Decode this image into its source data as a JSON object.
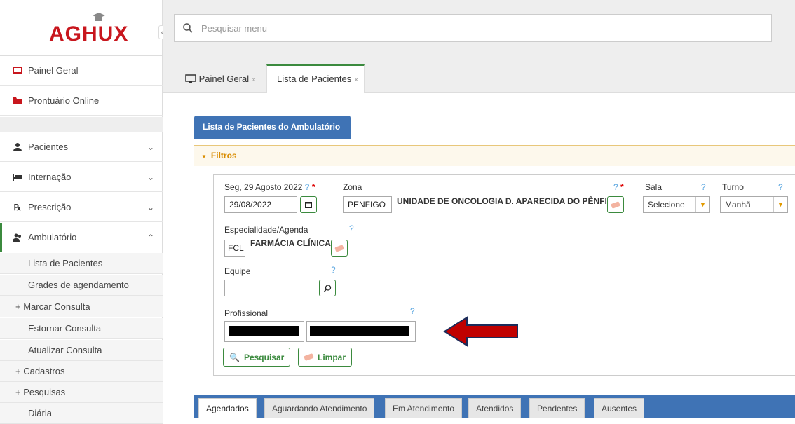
{
  "logo": {
    "text": "AGHUX"
  },
  "sidebar": {
    "collapse_label": "«",
    "items": [
      {
        "label": "Painel Geral",
        "icon": "monitor-icon"
      },
      {
        "label": "Prontuário Online",
        "icon": "folder-icon"
      },
      {
        "label": "Pacientes",
        "icon": "user-icon"
      },
      {
        "label": "Internação",
        "icon": "bed-icon"
      },
      {
        "label": "Prescrição",
        "icon": "prescription-icon"
      },
      {
        "label": "Ambulatório",
        "icon": "users-icon"
      }
    ],
    "subitems": [
      "Lista de Pacientes",
      "Grades de agendamento",
      "+  Marcar Consulta",
      "Estornar Consulta",
      "Atualizar Consulta",
      "+  Cadastros",
      "+  Pesquisas",
      "Diária"
    ]
  },
  "search": {
    "placeholder": "Pesquisar menu"
  },
  "tabs": [
    {
      "label": "Painel Geral",
      "close": "×"
    },
    {
      "label": "Lista de Pacientes",
      "close": "×"
    }
  ],
  "panel": {
    "title": "Lista de Pacientes do Ambulatório",
    "filtros": "Filtros"
  },
  "form": {
    "date_label": "Seg, 29 Agosto 2022",
    "date_value": "29/08/2022",
    "zona_label": "Zona",
    "zona_code": "PENFIGO",
    "zona_name": "UNIDADE DE ONCOLOGIA D. APARECIDA DO PÊNFIGO",
    "sala_label": "Sala",
    "sala_value": "Selecione",
    "turno_label": "Turno",
    "turno_value": "Manhã",
    "esp_label": "Especialidade/Agenda",
    "esp_code": "FCL",
    "esp_name": "FARMÁCIA CLÍNICA",
    "equipe_label": "Equipe",
    "prof_label": "Profissional",
    "help": "?",
    "required": "*"
  },
  "buttons": {
    "pesquisar": "Pesquisar",
    "limpar": "Limpar"
  },
  "bottom_tabs": [
    "Agendados",
    "Aguardando Atendimento",
    "Em Atendimento",
    "Atendidos",
    "Pendentes",
    "Ausentes"
  ],
  "colors": {
    "accent": "#3f73b5",
    "green": "#3b8a3e",
    "brand": "#c8161d",
    "arrow": "#c00000"
  }
}
